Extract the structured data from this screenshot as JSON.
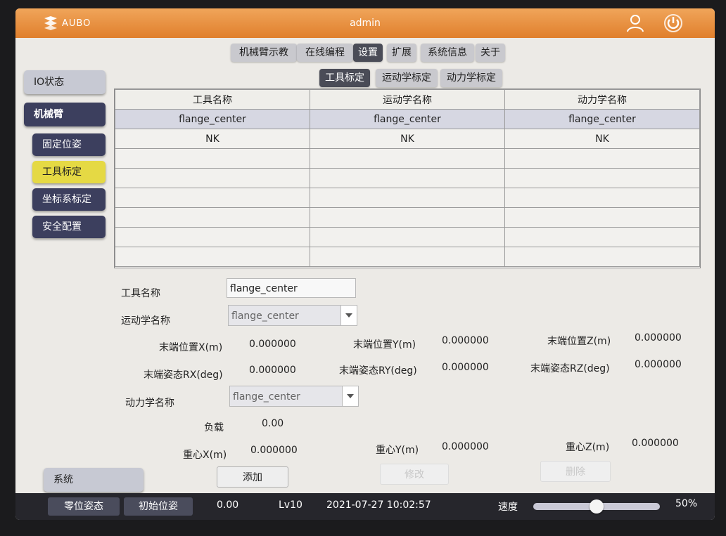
{
  "titlebar": {
    "brand": "AUBO",
    "user": "admin",
    "icons": [
      "aubo-logo-icon",
      "user-icon",
      "power-icon"
    ]
  },
  "top_tabs": [
    {
      "label": "机械臂示教",
      "active": false
    },
    {
      "label": "在线编程",
      "active": false
    },
    {
      "label": "设置",
      "active": true
    },
    {
      "label": "扩展",
      "active": false
    },
    {
      "label": "系统信息",
      "active": false
    },
    {
      "label": "关于",
      "active": false
    }
  ],
  "sub_tabs": [
    {
      "label": "工具标定",
      "active": true
    },
    {
      "label": "运动学标定",
      "active": false
    },
    {
      "label": "动力学标定",
      "active": false
    }
  ],
  "sidebar": {
    "items": [
      {
        "label": "IO状态"
      },
      {
        "label": "机械臂"
      },
      {
        "label": "固定位姿"
      },
      {
        "label": "工具标定"
      },
      {
        "label": "坐标系标定"
      },
      {
        "label": "安全配置"
      }
    ],
    "system_label": "系统"
  },
  "tool_table": {
    "columns": [
      "工具名称",
      "运动学名称",
      "动力学名称"
    ],
    "rows": [
      [
        "flange_center",
        "flange_center",
        "flange_center"
      ],
      [
        "NK",
        "NK",
        "NK"
      ]
    ],
    "selected_row": 0
  },
  "form": {
    "tool_name_label": "工具名称",
    "tool_name_value": "flange_center",
    "kin_name_label": "运动学名称",
    "kin_name_value": "flange_center",
    "end_pos_x_label": "末端位置X(m)",
    "end_pos_x": "0.000000",
    "end_pos_y_label": "末端位置Y(m)",
    "end_pos_y": "0.000000",
    "end_pos_z_label": "末端位置Z(m)",
    "end_pos_z": "0.000000",
    "end_rx_label": "末端姿态RX(deg)",
    "end_rx": "0.000000",
    "end_ry_label": "末端姿态RY(deg)",
    "end_ry": "0.000000",
    "end_rz_label": "末端姿态RZ(deg)",
    "end_rz": "0.000000",
    "dyn_name_label": "动力学名称",
    "dyn_name_value": "flange_center",
    "load_label": "负载",
    "load": "0.00",
    "cog_x_label": "重心X(m)",
    "cog_x": "0.000000",
    "cog_y_label": "重心Y(m)",
    "cog_y": "0.000000",
    "cog_z_label": "重心Z(m)",
    "cog_z": "0.000000"
  },
  "actions": {
    "add": "添加",
    "modify": "修改",
    "delete": "删除"
  },
  "bottombar": {
    "zero_pose": "零位姿态",
    "init_pose": "初始位姿",
    "value": "0.00",
    "level": "Lv10",
    "datetime": "2021-07-27 10:02:57",
    "speed_label": "速度",
    "speed_percent": "50%",
    "speed_fraction": 0.5
  },
  "colors": {
    "titlebar_orange": "#e58a36",
    "active_tab": "#4a4c57",
    "sidebar_dark": "#3c3f5e",
    "sidebar_highlight": "#e5d944",
    "bottombar": "#26262c"
  }
}
